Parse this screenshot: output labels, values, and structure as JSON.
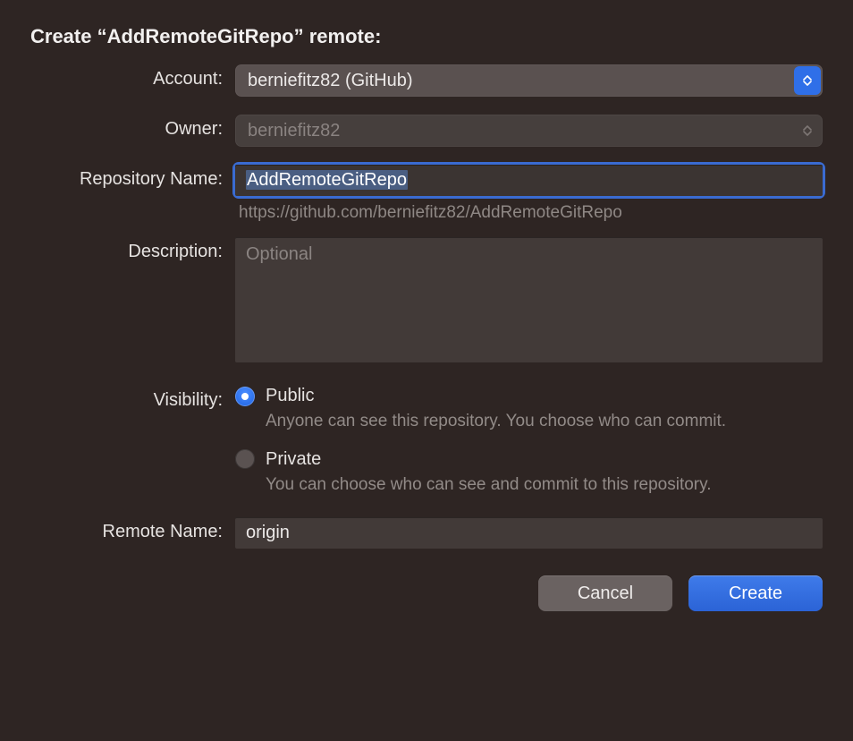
{
  "dialog": {
    "title": "Create “AddRemoteGitRepo” remote:"
  },
  "labels": {
    "account": "Account:",
    "owner": "Owner:",
    "repository_name": "Repository Name:",
    "description": "Description:",
    "visibility": "Visibility:",
    "remote_name": "Remote Name:"
  },
  "fields": {
    "account": "berniefitz82 (GitHub)",
    "owner": "berniefitz82",
    "repository_name": "AddRemoteGitRepo",
    "url_preview": "https://github.com/berniefitz82/AddRemoteGitRepo",
    "description_placeholder": "Optional",
    "remote_name": "origin"
  },
  "visibility": {
    "public": {
      "label": "Public",
      "description": "Anyone can see this repository. You choose who can commit."
    },
    "private": {
      "label": "Private",
      "description": "You can choose who can see and commit to this repository."
    }
  },
  "buttons": {
    "cancel": "Cancel",
    "create": "Create"
  }
}
